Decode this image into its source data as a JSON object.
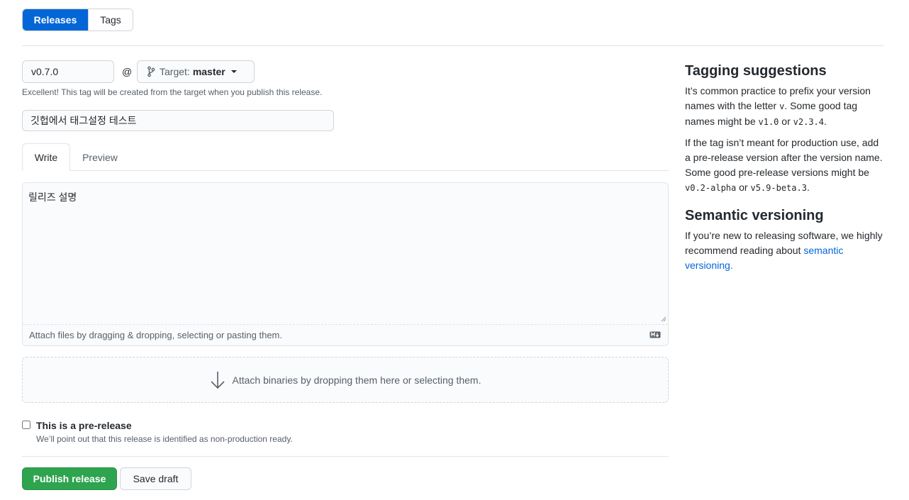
{
  "nav": {
    "releases_label": "Releases",
    "tags_label": "Tags"
  },
  "tag": {
    "value": "v0.7.0",
    "at": "@",
    "target_label": "Target:",
    "target_value": "master",
    "note": "Excellent! This tag will be created from the target when you publish this release."
  },
  "release_title": {
    "value": "깃헙에서 태그설정 테스트"
  },
  "editor": {
    "tabs": [
      {
        "label": "Write"
      },
      {
        "label": "Preview"
      }
    ],
    "body": "릴리즈 설명",
    "attach_text": "Attach files by dragging & dropping, selecting or pasting them."
  },
  "binaries": {
    "text": "Attach binaries by dropping them here or selecting them."
  },
  "prerelease": {
    "label": "This is a pre-release",
    "note": "We’ll point out that this release is identified as non-production ready."
  },
  "actions": {
    "publish_label": "Publish release",
    "draft_label": "Save draft"
  },
  "sidebar": {
    "tagging_title": "Tagging suggestions",
    "p1_a": "It’s common practice to prefix your version names with the letter ",
    "p1_code1": "v",
    "p1_b": ". Some good tag names might be ",
    "p1_code2": "v1.0",
    "p1_c": " or ",
    "p1_code3": "v2.3.4",
    "p1_d": ".",
    "p2_a": "If the tag isn’t meant for production use, add a pre-release version after the version name. Some good pre-release versions might be ",
    "p2_code1": "v0.2-alpha",
    "p2_b": " or ",
    "p2_code2": "v5.9-beta.3",
    "p2_c": ".",
    "semver_title": "Semantic versioning",
    "p3_a": "If you’re new to releasing software, we highly recommend reading about ",
    "p3_link": "semantic versioning.",
    "colors": {
      "link": "#0366d6",
      "primary": "#0366d6",
      "success": "#2ea44f"
    }
  }
}
